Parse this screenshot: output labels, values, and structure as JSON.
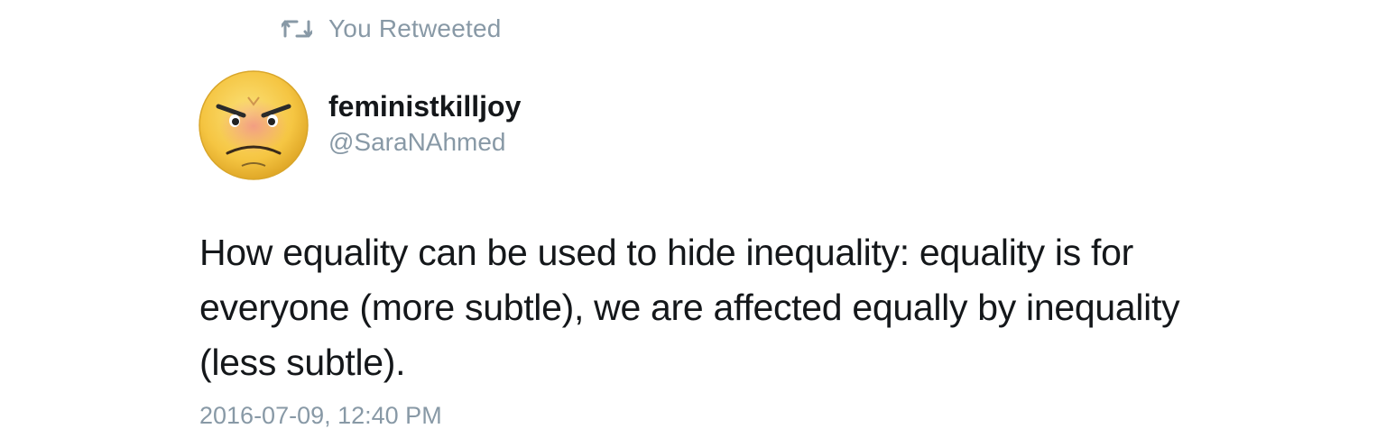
{
  "social_context": {
    "icon": "retweet-icon",
    "label": "You Retweeted"
  },
  "tweet": {
    "avatar_icon": "angry-face-icon",
    "display_name": "feministkilljoy",
    "handle": "@SaraNAhmed",
    "text": "How equality can be used to hide inequality: equality is for everyone (more subtle), we are affected equally by inequality (less subtle).",
    "timestamp": "2016-07-09, 12:40 PM"
  },
  "colors": {
    "secondary_text": "#8899a6",
    "primary_text": "#14171a",
    "background": "#ffffff"
  }
}
